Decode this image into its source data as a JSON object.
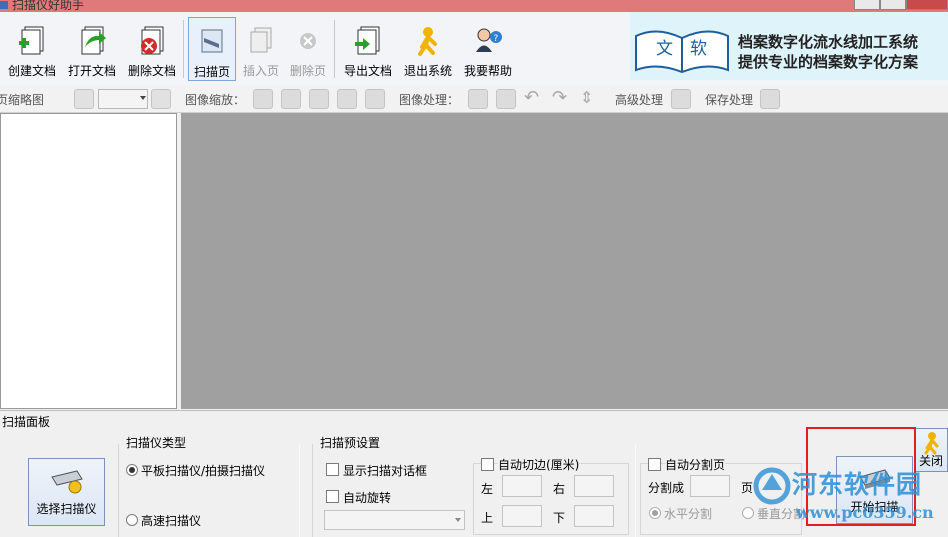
{
  "window": {
    "title": "扫描仪好助手"
  },
  "toolbar": {
    "buttons": [
      {
        "label": "创建文档",
        "icon": "create-document-icon",
        "enabled": true
      },
      {
        "label": "打开文档",
        "icon": "open-document-icon",
        "enabled": true
      },
      {
        "label": "删除文档",
        "icon": "delete-document-icon",
        "enabled": true
      },
      {
        "label": "扫描页",
        "icon": "scan-page-icon",
        "enabled": true,
        "active": true
      },
      {
        "label": "插入页",
        "icon": "insert-page-icon",
        "enabled": false
      },
      {
        "label": "删除页",
        "icon": "delete-page-icon",
        "enabled": false
      },
      {
        "label": "导出文档",
        "icon": "export-document-icon",
        "enabled": true
      },
      {
        "label": "退出系统",
        "icon": "exit-icon",
        "enabled": true
      },
      {
        "label": "我要帮助",
        "icon": "help-icon",
        "enabled": true
      }
    ],
    "banner": {
      "logo_text": [
        "文",
        "软"
      ],
      "line1": "档案数字化流水线加工系统",
      "line2": "提供专业的档案数字化方案"
    }
  },
  "toolbar2": {
    "thumbnail_label": "页缩略图",
    "zoom_label": "图像缩放：",
    "process_label": "图像处理：",
    "advanced_label": "高级处理",
    "save_label": "保存处理"
  },
  "panel": {
    "title": "扫描面板",
    "select_scanner_button": "选择扫描仪",
    "scanner_type": {
      "title": "扫描仪类型",
      "options": [
        {
          "label": "平板扫描仪/拍摄扫描仪",
          "selected": true
        },
        {
          "label": "高速扫描仪",
          "selected": false
        }
      ]
    },
    "preset": {
      "title": "扫描预设置",
      "show_dialog": "显示扫描对话框",
      "auto_rotate": "自动旋转"
    },
    "auto_crop": {
      "label": "自动切边(厘米)",
      "left": "左",
      "right": "右",
      "top": "上",
      "bottom": "下"
    },
    "auto_split": {
      "label": "自动分割页",
      "split_into": "分割成",
      "page_unit": "页",
      "horizontal": "水平分割",
      "vertical": "垂直分割"
    },
    "start_scan_button": "开始扫描",
    "close_button": "关闭"
  },
  "watermark": {
    "line1": "河东软件园",
    "line2": "www.pc0359.cn"
  },
  "colors": {
    "titlebar": "#e07a7a",
    "preview_bg": "#a0a0a0",
    "highlight": "#e02020",
    "watermark": "#2d8fd4"
  }
}
